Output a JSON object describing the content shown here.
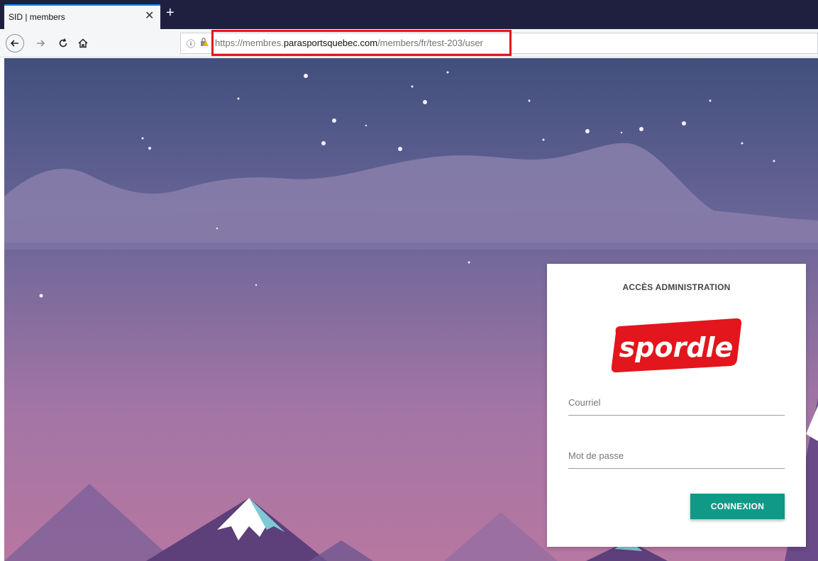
{
  "browser": {
    "tab_title": "SID | members",
    "tab_close": "✕",
    "new_tab": "+",
    "url_prefix": "https://membres.",
    "url_domain": "parasportsquebec.com",
    "url_path": "/members/fr/test-203/user"
  },
  "card": {
    "title": "ACCÈS ADMINISTRATION",
    "logo_text": "spordle",
    "email_placeholder": "Courriel",
    "password_placeholder": "Mot de passe",
    "submit_label": "CONNEXION"
  },
  "colors": {
    "accent": "#0f9a87",
    "logo_red": "#e3161d",
    "highlight_red": "#e3161d"
  }
}
